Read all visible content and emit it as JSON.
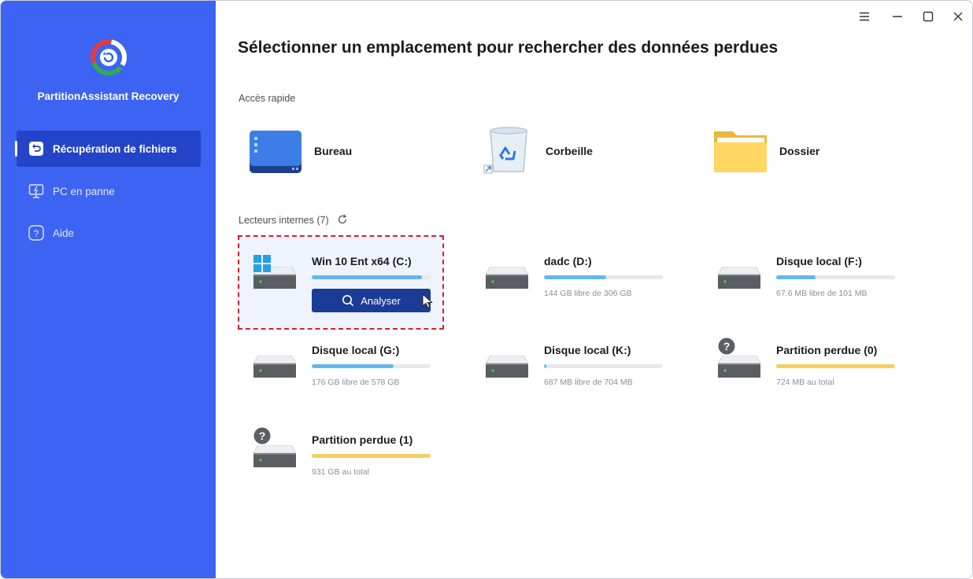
{
  "app": {
    "name": "PartitionAssistant Recovery"
  },
  "sidebar": {
    "items": [
      {
        "label": "Récupération de fichiers",
        "icon": "undo-file-icon",
        "active": true
      },
      {
        "label": "PC en panne",
        "icon": "crashed-pc-icon",
        "active": false
      },
      {
        "label": "Aide",
        "icon": "help-icon",
        "active": false
      }
    ]
  },
  "window_controls": [
    "menu-icon",
    "minimize-icon",
    "maximize-icon",
    "close-icon"
  ],
  "main": {
    "title": "Sélectionner un emplacement pour rechercher des données perdues",
    "quick_access": {
      "label": "Accès rapide",
      "items": [
        {
          "label": "Bureau",
          "icon": "desktop-icon"
        },
        {
          "label": "Corbeille",
          "icon": "recycle-bin-icon"
        },
        {
          "label": "Dossier",
          "icon": "folder-icon"
        }
      ]
    },
    "internal_drives": {
      "label": "Lecteurs internes (7)",
      "drives": [
        {
          "name": "Win 10 Ent x64 (C:)",
          "info": "",
          "fill": 0.93,
          "type": "system",
          "selected": true,
          "button": "Analyser"
        },
        {
          "name": "dadc (D:)",
          "info": "144 GB libre de 306 GB",
          "fill": 0.52,
          "type": "normal"
        },
        {
          "name": "Disque local (F:)",
          "info": "67.6 MB libre de 101 MB",
          "fill": 0.33,
          "type": "normal"
        },
        {
          "name": "Disque local (G:)",
          "info": "176 GB libre de 578 GB",
          "fill": 0.69,
          "type": "normal"
        },
        {
          "name": "Disque local (K:)",
          "info": "687 MB libre de 704 MB",
          "fill": 0.02,
          "type": "normal"
        },
        {
          "name": "Partition perdue (0)",
          "info": "724 MB au total",
          "fill": 1.0,
          "type": "lost"
        },
        {
          "name": "Partition perdue (1)",
          "info": "931 GB au total",
          "fill": 1.0,
          "type": "lost"
        }
      ]
    }
  },
  "colors": {
    "sidebar": "#3d63f2",
    "sidebar_active": "#2344c8",
    "scan_button": "#1b3c96",
    "usage_bar": "#62b8ee",
    "lost_bar": "#f3d060",
    "selection_outline": "#d8202b"
  }
}
